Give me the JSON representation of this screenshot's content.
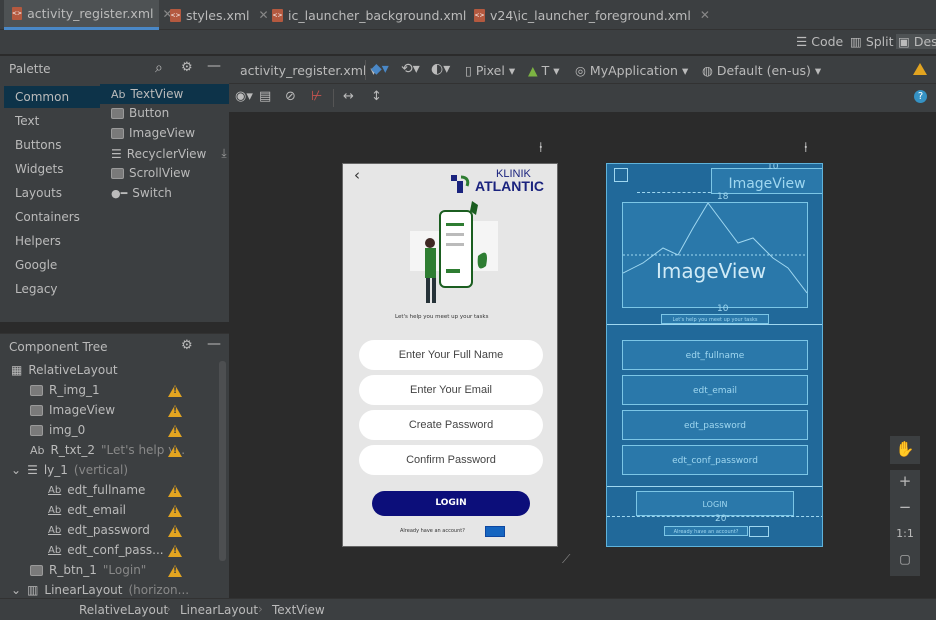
{
  "tabs": [
    {
      "label": "activity_register.xml",
      "active": true
    },
    {
      "label": "styles.xml",
      "active": false
    },
    {
      "label": "ic_launcher_background.xml",
      "active": false
    },
    {
      "label": "v24\\ic_launcher_foreground.xml",
      "active": false
    }
  ],
  "view_modes": {
    "code": "Code",
    "split": "Split",
    "design": "Des"
  },
  "palette": {
    "title": "Palette",
    "categories": [
      "Common",
      "Text",
      "Buttons",
      "Widgets",
      "Layouts",
      "Containers",
      "Helpers",
      "Google",
      "Legacy"
    ],
    "components": [
      {
        "prefix": "Ab",
        "label": "TextView"
      },
      {
        "label": "Button"
      },
      {
        "label": "ImageView"
      },
      {
        "label": "RecyclerView"
      },
      {
        "label": "ScrollView"
      },
      {
        "label": "Switch"
      }
    ]
  },
  "component_tree": {
    "title": "Component Tree",
    "nodes": [
      {
        "label": "RelativeLayout",
        "extra": ""
      },
      {
        "label": "R_img_1",
        "extra": ""
      },
      {
        "label": "ImageView",
        "extra": ""
      },
      {
        "label": "img_0",
        "extra": ""
      },
      {
        "label": "R_txt_2",
        "extra": "\"Let's help y..."
      },
      {
        "label": "ly_1",
        "extra": "(vertical)"
      },
      {
        "label": "edt_fullname",
        "extra": ""
      },
      {
        "label": "edt_email",
        "extra": ""
      },
      {
        "label": "edt_password",
        "extra": ""
      },
      {
        "label": "edt_conf_pass...",
        "extra": ""
      },
      {
        "label": "R_btn_1",
        "extra": "\"Login\""
      },
      {
        "label": "LinearLayout",
        "extra": "(horizon..."
      }
    ]
  },
  "toolbar": {
    "file": "activity_register.xml",
    "device": "Pixel",
    "api": "T",
    "theme": "MyApplication",
    "locale": "Default (en-us)"
  },
  "design": {
    "brand_top": "KLINIK",
    "brand_bottom": "ATLANTIC",
    "tagline": "Let's help you meet up your tasks",
    "fields": [
      "Enter Your Full Name",
      "Enter Your Email",
      "Create Password",
      "Confirm Password"
    ],
    "button": "LOGIN",
    "footer": "Already have an account?"
  },
  "blueprint": {
    "image_top": "ImageView",
    "image_main": "ImageView",
    "tagline": "Let's help you meet up your tasks",
    "fields": [
      "edt_fullname",
      "edt_email",
      "edt_password",
      "edt_conf_password"
    ],
    "button": "LOGIN",
    "footer": "Already have an account?",
    "margins": [
      "10",
      "18",
      "10",
      "20"
    ]
  },
  "zoom_tools": {
    "fit": "1:1"
  },
  "breadcrumbs": [
    "RelativeLayout",
    "LinearLayout",
    "TextView"
  ],
  "colors": {
    "accent": "#4a88c7",
    "warning": "#e2a420",
    "login_button": "#0c0e7a",
    "blueprint": "#21699a",
    "brand": "#1a237e",
    "brand_green": "#2e7d32"
  }
}
